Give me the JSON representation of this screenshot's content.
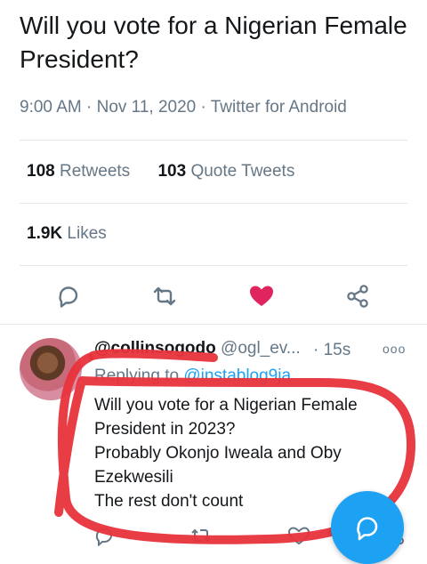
{
  "tweet": {
    "text": "Will you vote for a Nigerian Female President?",
    "time": "9:00 AM · Nov 11, 2020 · Twitter for Android"
  },
  "stats": {
    "retweets_count": "108",
    "retweets_label": "Retweets",
    "quote_count": "103",
    "quote_label": "Quote Tweets",
    "likes_count": "1.9K",
    "likes_label": "Likes"
  },
  "actions": {
    "reply_icon": "reply-icon",
    "retweet_icon": "retweet-icon",
    "like_icon": "heart-icon",
    "share_icon": "share-icon",
    "liked": true,
    "like_color": "#e0245e",
    "icon_color": "#657786"
  },
  "reply": {
    "name": "@collinsogodo",
    "handle": "@ogl_ev...",
    "time": "· 15s",
    "more": "ooo",
    "replying_prefix": "Replying to",
    "replying_to": "@instablog9ja",
    "lines": [
      "Will you vote for a Nigerian Female",
      "President in 2023?",
      "Probably Okonjo Iweala and Oby",
      "Ezekwesili",
      "The rest don't count"
    ]
  },
  "colors": {
    "accent": "#1da1f2",
    "highlight": "#e8333c",
    "secondary_text": "#657786"
  }
}
